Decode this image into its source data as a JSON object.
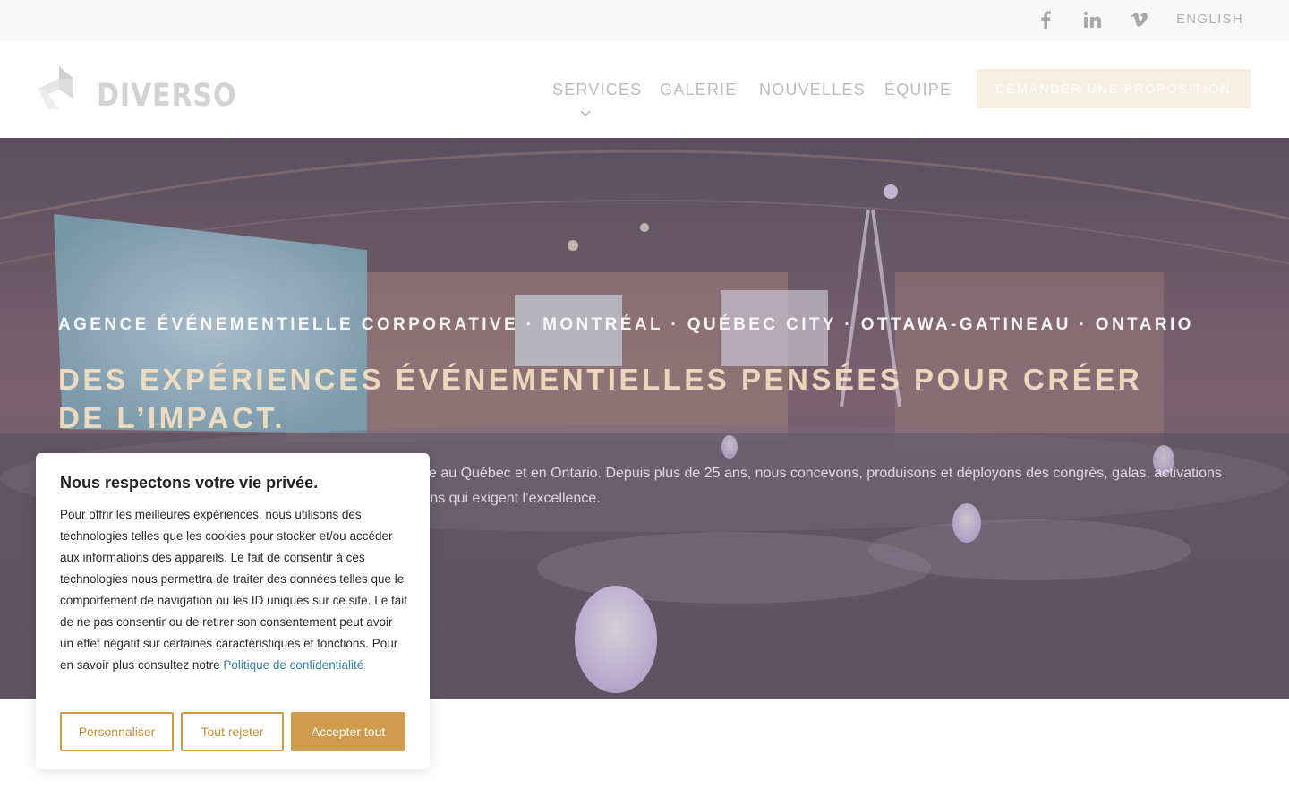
{
  "topbar": {
    "social": [
      {
        "name": "facebook",
        "icon": "facebook-icon"
      },
      {
        "name": "linkedin",
        "icon": "linkedin-icon"
      },
      {
        "name": "vimeo",
        "icon": "vimeo-icon"
      }
    ],
    "language": "ENGLISH"
  },
  "header": {
    "logo_text": "DIVERSO",
    "nav": {
      "services": "SERVICES",
      "galerie": "GALERIE",
      "nouvelles": "NOUVELLES",
      "equipe": "ÉQUIPE"
    },
    "cta": "DEMANDER UNE PROPOSITION"
  },
  "hero": {
    "kicker": "AGENCE ÉVÉNEMENTIELLE CORPORATIVE · MONTRÉAL · QUÉBEC CITY · OTTAWA-GATINEAU · ONTARIO",
    "title": "DES EXPÉRIENCES ÉVÉNEMENTIELLES PENSÉES POUR CRÉER DE L’IMPACT.",
    "description": "tive au Québec et en Ontario. Depuis plus de 25 ans, nous concevons, produisons et déployons des congrès, galas, activations de r mesure pour les entreprises, organisations et institutions qui exigent l’excellence."
  },
  "cookie": {
    "title": "Nous respectons votre vie privée.",
    "body": "Pour offrir les meilleures expériences, nous utilisons des technologies telles que les cookies pour stocker et/ou accéder aux informations des appareils. Le fait de consentir à ces technologies nous permettra de traiter des données telles que le comportement de navigation ou les ID uniques sur ce site. Le fait de ne pas consentir ou de retirer son consentement peut avoir un effet négatif sur certaines caractéristiques et fonctions. Pour en savoir plus consultez notre ",
    "policy_link": "Politique de confidentialité",
    "buttons": {
      "customize": "Personnaliser",
      "reject": "Tout rejeter",
      "accept": "Accepter tout"
    }
  },
  "colors": {
    "accent": "#d09b4c",
    "cta_bg": "#f8efe3",
    "link": "#3a7fa6",
    "hero_title": "#f6e3c4"
  }
}
